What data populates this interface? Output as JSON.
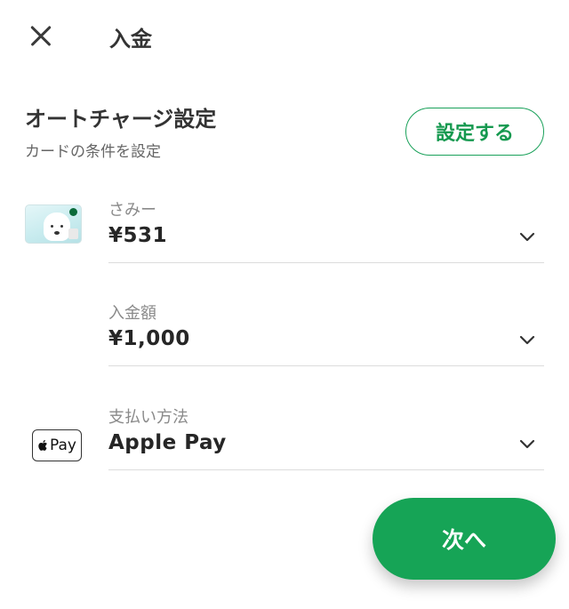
{
  "header": {
    "title": "入金"
  },
  "auto_charge": {
    "title": "オートチャージ設定",
    "subtitle": "カードの条件を設定",
    "setup_button": "設定する"
  },
  "card_row": {
    "label": "さみー",
    "value": "¥531",
    "icon": "bear-card-icon"
  },
  "amount_row": {
    "label": "入金額",
    "value": "¥1,000"
  },
  "payment_row": {
    "label": "支払い方法",
    "value": "Apple Pay",
    "badge_text": "Pay",
    "icon": "apple-pay-icon"
  },
  "next_button": {
    "label": "次へ"
  },
  "colors": {
    "accent": "#16a456",
    "divider": "#dcdcdc"
  }
}
